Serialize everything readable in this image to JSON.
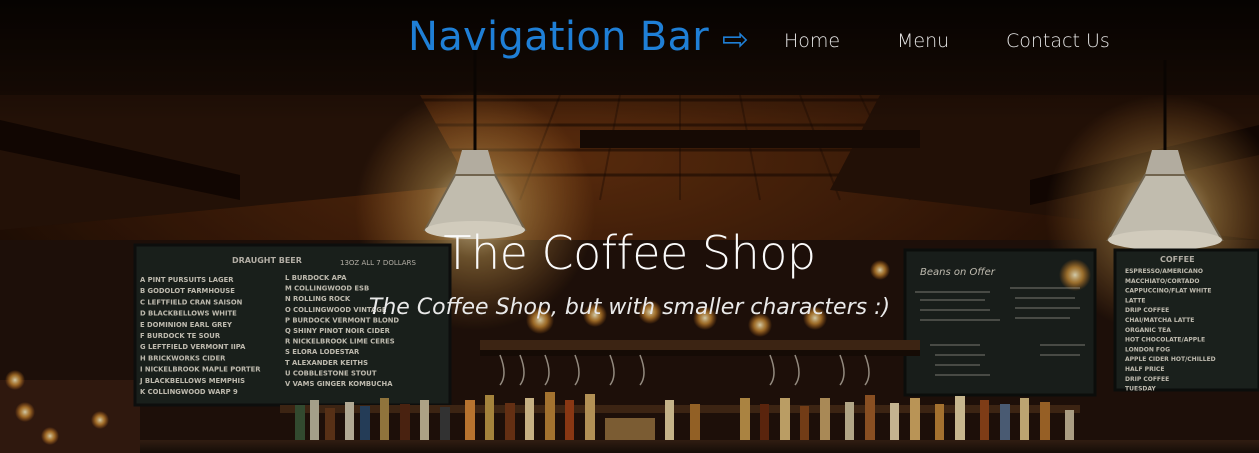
{
  "nav": {
    "brand": "Navigation Bar",
    "brand_arrow": "⇨",
    "links": [
      {
        "label": "Home"
      },
      {
        "label": "Menu"
      },
      {
        "label": "Contact Us"
      }
    ]
  },
  "hero": {
    "title": "The Coffee Shop",
    "subtitle": "The Coffee Shop, but with smaller characters :)"
  },
  "background": {
    "beer_board": {
      "heading": "DRAUGHT BEER",
      "sizes": "13OZ   ALL 7 DOLLARS",
      "left_col": [
        "A PINT PURSUITS LAGER",
        "B GODOLOT   FARMHOUSE",
        "C LEFTFIELD CRAN SAISON",
        "D BLACKBELLOWS WHITE",
        "E DOMINION EARL GREY",
        "F BURDOCK TE   SOUR",
        "G LEFTFIELD VERMONT IIPA",
        "H BRICKWORKS CIDER",
        "I NICKELBROOK MAPLE PORTER",
        "J BLACKBELLOWS MEMPHIS",
        "K COLLINGWOOD WARP 9"
      ],
      "right_col": [
        "L BURDOCK   APA",
        "M COLLINGWOOD ESB",
        "N ROLLING ROCK",
        "O COLLINGWOOD VINTAGE",
        "P BURDOCK VERMONT BLOND",
        "Q SHINY PINOT NOIR CIDER",
        "R NICKELBROOK LIME CERES",
        "S ELORA LODESTAR",
        "T ALEXANDER KEITHS",
        "U COBBLESTONE STOUT",
        "V VAMS GINGER KOMBUCHA"
      ]
    },
    "beans_board": {
      "heading": "Beans on Offer"
    },
    "coffee_board": {
      "heading": "COFFEE",
      "items": [
        "ESPRESSO/AMERICANO",
        "MACCHIATO/CORTADO",
        "CAPPUCCINO/FLAT WHITE",
        "LATTE",
        "DRIP COFFEE",
        "CHAI/MATCHA LATTE",
        "ORGANIC TEA",
        "HOT CHOCOLATE/APPLE",
        "LONDON FOG",
        "APPLE CIDER HOT/CHILLED",
        "HALF PRICE",
        "DRIP COFFEE",
        "TUESDAY"
      ]
    }
  }
}
